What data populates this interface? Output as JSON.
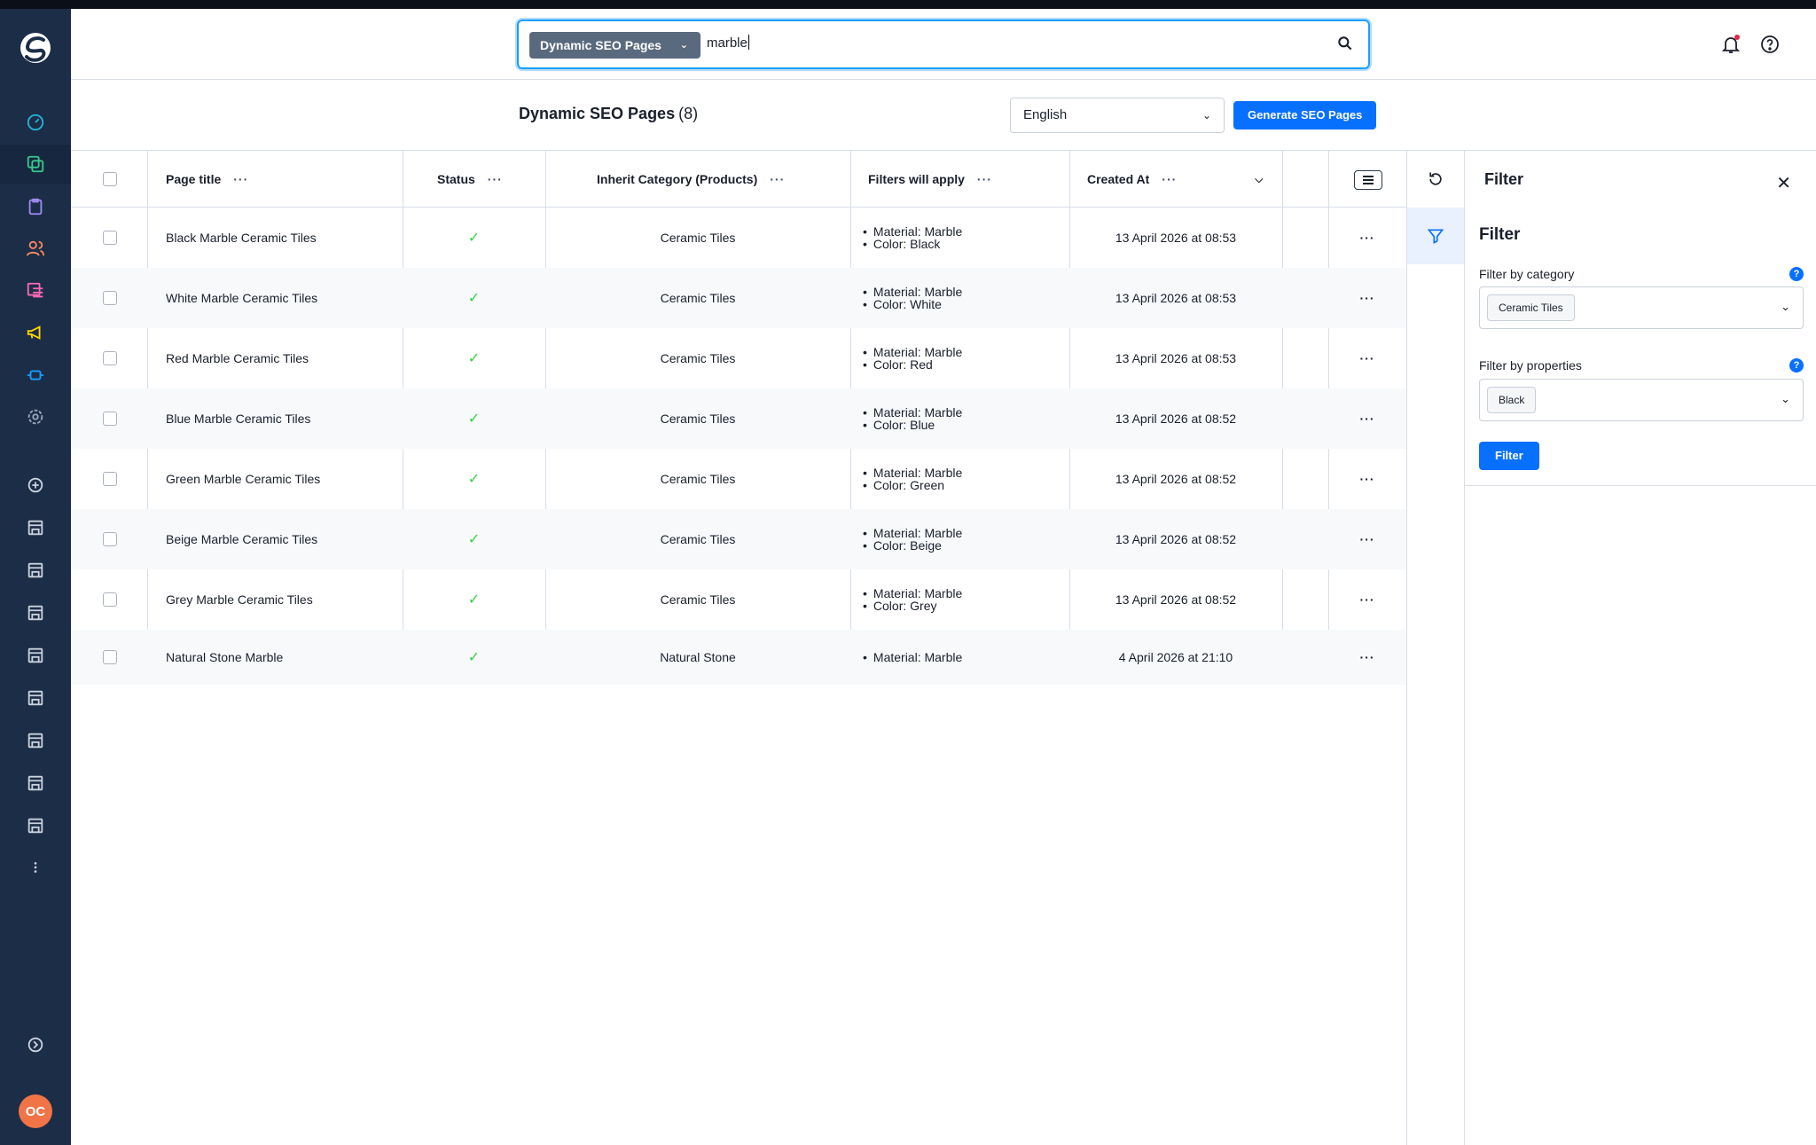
{
  "search": {
    "type_label": "Dynamic SEO Pages",
    "value": "marble"
  },
  "page": {
    "title": "Dynamic SEO Pages",
    "count": "(8)",
    "language": "English",
    "generate_label": "Generate SEO Pages"
  },
  "table": {
    "headers": {
      "page_title": "Page title",
      "status": "Status",
      "category": "Inherit Category (Products)",
      "filters": "Filters will apply",
      "created": "Created At"
    },
    "rows": [
      {
        "title": "Black Marble Ceramic Tiles",
        "category": "Ceramic Tiles",
        "filters": [
          "Material: Marble",
          "Color: Black"
        ],
        "created": "13 April 2026 at 08:53"
      },
      {
        "title": "White Marble Ceramic Tiles",
        "category": "Ceramic Tiles",
        "filters": [
          "Material: Marble",
          "Color: White"
        ],
        "created": "13 April 2026 at 08:53"
      },
      {
        "title": "Red Marble Ceramic Tiles",
        "category": "Ceramic Tiles",
        "filters": [
          "Material: Marble",
          "Color: Red"
        ],
        "created": "13 April 2026 at 08:53"
      },
      {
        "title": "Blue Marble Ceramic Tiles",
        "category": "Ceramic Tiles",
        "filters": [
          "Material: Marble",
          "Color: Blue"
        ],
        "created": "13 April 2026 at 08:52"
      },
      {
        "title": "Green Marble Ceramic Tiles",
        "category": "Ceramic Tiles",
        "filters": [
          "Material: Marble",
          "Color: Green"
        ],
        "created": "13 April 2026 at 08:52"
      },
      {
        "title": "Beige Marble Ceramic Tiles",
        "category": "Ceramic Tiles",
        "filters": [
          "Material: Marble",
          "Color: Beige"
        ],
        "created": "13 April 2026 at 08:52"
      },
      {
        "title": "Grey Marble Ceramic Tiles",
        "category": "Ceramic Tiles",
        "filters": [
          "Material: Marble",
          "Color: Grey"
        ],
        "created": "13 April 2026 at 08:52"
      },
      {
        "title": "Natural Stone Marble",
        "category": "Natural Stone",
        "filters": [
          "Material: Marble"
        ],
        "created": "4 April 2026 at 21:10"
      }
    ]
  },
  "filter_panel": {
    "title": "Filter",
    "heading": "Filter",
    "category_label": "Filter by category",
    "category_value": "Ceramic Tiles",
    "properties_label": "Filter by properties",
    "properties_value": "Black",
    "button_label": "Filter"
  },
  "user": {
    "initials": "OC"
  },
  "colors": {
    "sidebar": "#1c2d47",
    "primary": "#0870ff",
    "status_ok": "#37d046",
    "avatar": "#f07446"
  }
}
